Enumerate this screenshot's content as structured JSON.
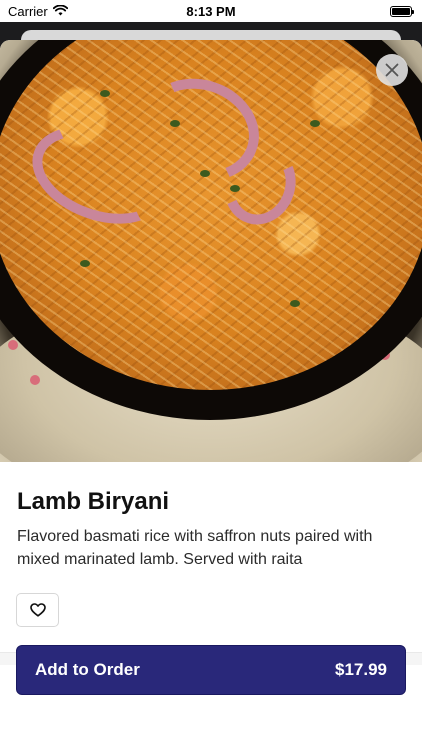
{
  "status_bar": {
    "carrier": "Carrier",
    "time": "8:13 PM",
    "icons": [
      "wifi-icon",
      "battery-icon"
    ]
  },
  "item": {
    "name": "Lamb Biryani",
    "description": "Flavored basmati rice with saffron nuts paired with mixed marinated lamb. Served with raita",
    "image": "lamb-biryani-photo"
  },
  "actions": {
    "close_icon": "close-icon",
    "favorite_icon": "heart-icon",
    "add_to_order_label": "Add to Order",
    "price": "$17.99"
  },
  "colors": {
    "primary_button": "#29287a",
    "text": "#111111"
  }
}
